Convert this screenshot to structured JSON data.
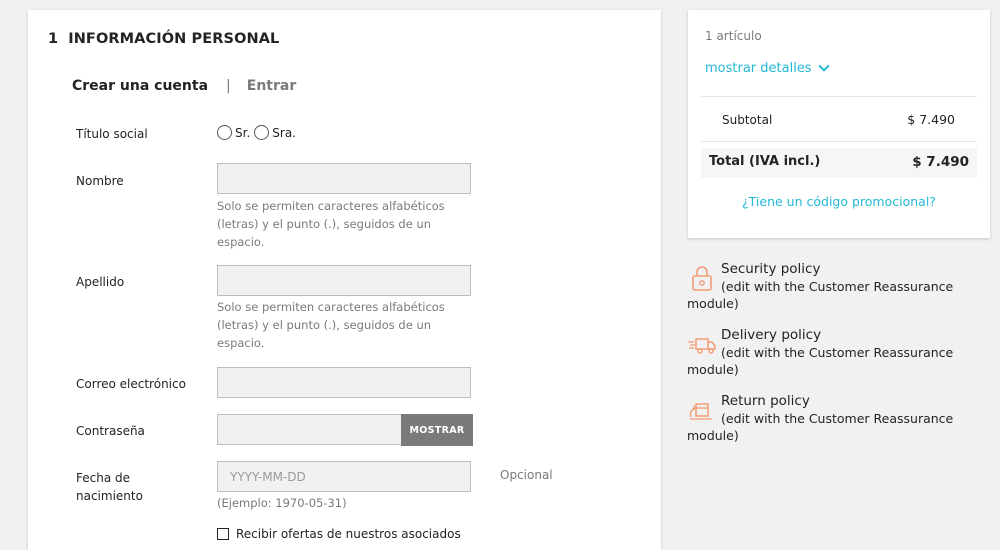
{
  "section": {
    "number": "1",
    "title": "INFORMACIÓN PERSONAL"
  },
  "auth_tabs": {
    "create": "Crear una cuenta",
    "separator": "|",
    "login": "Entrar"
  },
  "form": {
    "social_title": {
      "label": "Título social",
      "options": [
        "Sr.",
        "Sra."
      ]
    },
    "first_name": {
      "label": "Nombre",
      "value": "",
      "hint": "Solo se permiten caracteres alfabéticos (letras) y el punto (.), seguidos de un espacio."
    },
    "last_name": {
      "label": "Apellido",
      "value": "",
      "hint": "Solo se permiten caracteres alfabéticos (letras) y el punto (.), seguidos de un espacio."
    },
    "email": {
      "label": "Correo electrónico",
      "value": ""
    },
    "password": {
      "label": "Contraseña",
      "value": "",
      "show_button": "MOSTRAR"
    },
    "birthdate": {
      "label_line1": "Fecha de",
      "label_line2": "nacimiento",
      "placeholder": "YYYY-MM-DD",
      "hint": "(Ejemplo: 1970-05-31)",
      "optional": "Opcional"
    },
    "offers": {
      "label": "Recibir ofertas de nuestros asociados"
    }
  },
  "summary": {
    "items_count": "1 artículo",
    "show_details": "mostrar detalles",
    "subtotal_label": "Subtotal",
    "subtotal_value": "$ 7.490",
    "total_label": "Total (IVA incl.)",
    "total_value": "$ 7.490",
    "promo_link": "¿Tiene un código promocional?"
  },
  "reassurance": [
    {
      "icon": "lock-icon",
      "title": "Security policy",
      "desc": "(edit with the Customer Reassurance module)"
    },
    {
      "icon": "truck-icon",
      "title": "Delivery policy",
      "desc": "(edit with the Customer Reassurance module)"
    },
    {
      "icon": "return-icon",
      "title": "Return policy",
      "desc": "(edit with the Customer Reassurance module)"
    }
  ],
  "colors": {
    "accent": "#24b9d7",
    "icon": "#f19d76",
    "button": "#7a7a7a"
  }
}
